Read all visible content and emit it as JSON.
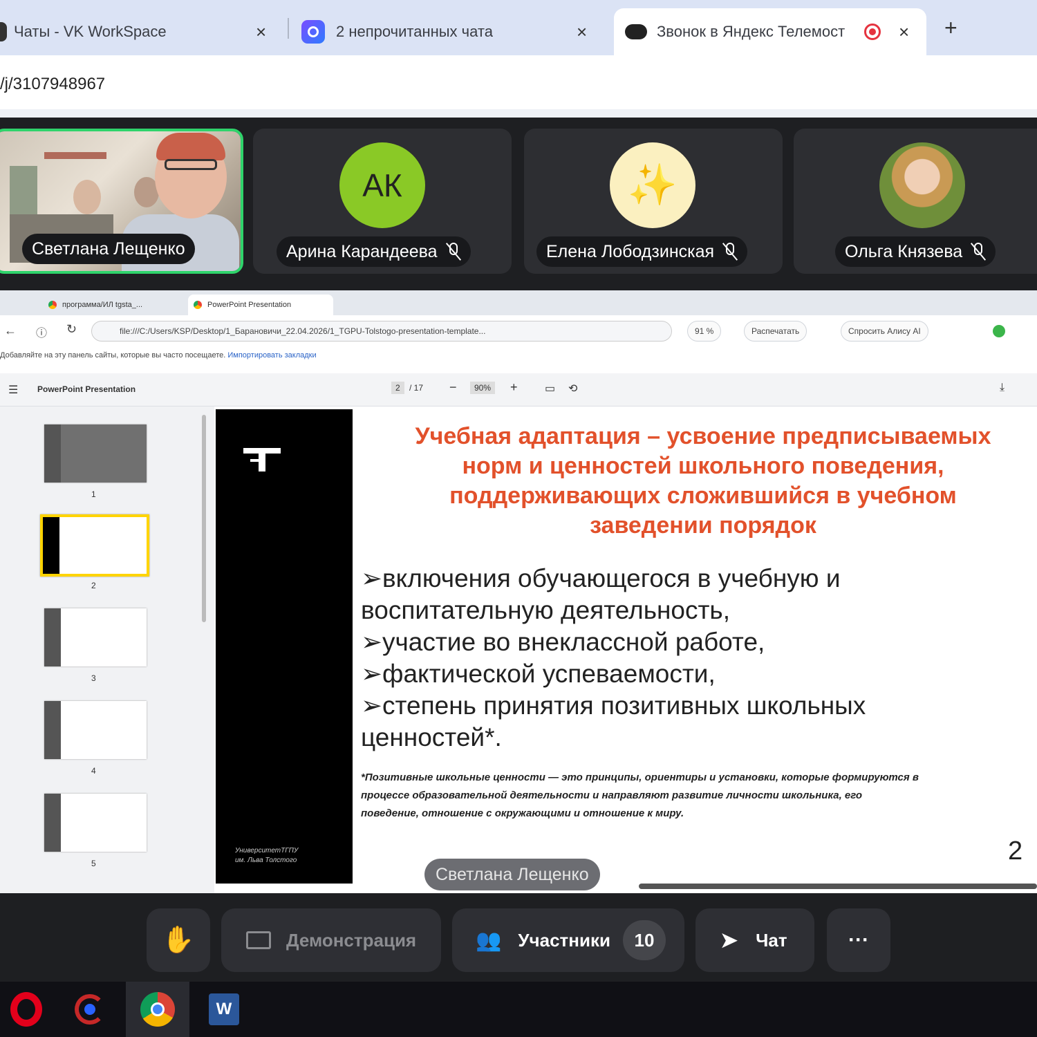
{
  "browser": {
    "tabs": [
      {
        "title": "Чаты - VK WorkSpace"
      },
      {
        "title": "2 непрочитанных чата"
      },
      {
        "title": "Звонок в Яндекс Телемост"
      }
    ],
    "url": "/j/3107948967"
  },
  "participants": [
    {
      "name": "Светлана Лещенко",
      "speaking": true
    },
    {
      "name": "Арина Карандеева",
      "initials": "АК",
      "color": "#8ac926"
    },
    {
      "name": "Елена Лободзинская",
      "emoji": "✨",
      "color": "#fbf0c0"
    },
    {
      "name": "Ольга Князева"
    }
  ],
  "shared_screen": {
    "tabs": [
      "программа/ИЛ tgsta_...",
      "PowerPoint Presentation"
    ],
    "url": "file:///C:/Users/KSP/Desktop/1_Барановичи_22.04.2026/1_TGPU-Tolstogo-presentation-template...",
    "zoom": "91 %",
    "print_label": "Распечатать",
    "ask_ai_label": "Спросить Алису AI",
    "bookmark_hint": "Добавляйте на эту панель сайты, которые вы часто посещаете.",
    "bookmark_link": "Импортировать закладки",
    "pdf_title": "PowerPoint Presentation",
    "page": "2",
    "page_total": "/ 17",
    "pdf_zoom": "90%",
    "thumbnail_numbers": [
      "1",
      "2",
      "3",
      "4",
      "5"
    ],
    "slide": {
      "title_lines": [
        "Учебная адаптация – усвоение предписываемых",
        "норм и ценностей школьного поведения,",
        "поддерживающих сложившийся в учебном",
        "заведении порядок"
      ],
      "bullet_lines": [
        "➢включения обучающегося в учебную и",
        "воспитательную деятельность,",
        "➢участие во внеклассной работе,",
        "➢фактической успеваемости,",
        "➢степень принятия позитивных школьных",
        "ценностей*."
      ],
      "footnote_lines": [
        "*Позитивные школьные ценности — это принципы, ориентиры и установки, которые формируются в",
        "процессе образовательной деятельности и направляют развитие личности школьника, его",
        "поведение, отношение с окружающими и отношение к миру."
      ],
      "page_number": "2",
      "university": "УниверситетТГПУ",
      "university_sub": "им. Льва Толстого"
    },
    "presenter": "Светлана Лещенко"
  },
  "controls": {
    "demo_label": "Демонстрация",
    "participants_label": "Участники",
    "participants_count": "10",
    "chat_label": "Чат",
    "more_label": "···"
  },
  "colors": {
    "accent_green": "#2fd36b",
    "slide_title": "#e2512b",
    "thumb_active": "#ffd400"
  }
}
